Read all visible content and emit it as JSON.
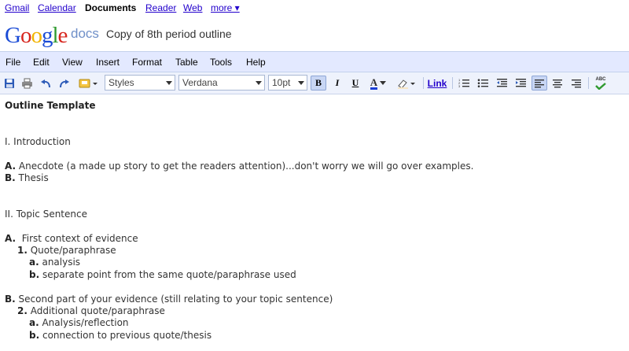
{
  "top_nav": {
    "gmail": "Gmail",
    "calendar": "Calendar",
    "documents": "Documents",
    "reader": "Reader",
    "web": "Web",
    "more": "more ▾"
  },
  "header": {
    "logo_letters": [
      "G",
      "o",
      "o",
      "g",
      "l",
      "e"
    ],
    "logo_colors": [
      "#1a4bd6",
      "#d7261e",
      "#f2b400",
      "#1a4bd6",
      "#2f9a2f",
      "#d7261e"
    ],
    "product": "docs",
    "doc_title": "Copy of 8th period outline"
  },
  "menu": {
    "file": "File",
    "edit": "Edit",
    "view": "View",
    "insert": "Insert",
    "format": "Format",
    "table": "Table",
    "tools": "Tools",
    "help": "Help"
  },
  "toolbar": {
    "styles": "Styles",
    "font": "Verdana",
    "size": "10pt",
    "bold": "B",
    "italic": "I",
    "underline": "U",
    "text_color": "A",
    "link": "Link",
    "spellcheck": "ABC"
  },
  "document": {
    "title": "Outline Template",
    "lines": {
      "intro": "I. Introduction",
      "a1_marker": "A.",
      "a1_text": " Anecdote (a made up story to get the readers attention)...don't worry we will go over examples.",
      "b1_marker": "B.",
      "b1_text": " Thesis",
      "topic": "II. Topic Sentence",
      "a2_marker": "A.",
      "a2_text": "  First context of evidence",
      "n1_marker": "1.",
      "n1_text": " Quote/paraphrase",
      "n1a_marker": "a.",
      "n1a_text": " analysis",
      "n1b_marker": "b.",
      "n1b_text": " separate point from the same quote/paraphrase used",
      "b2_marker": "B.",
      "b2_text": " Second part of your evidence (still relating to your topic sentence)",
      "n2_marker": "2.",
      "n2_text": " Additional quote/paraphrase",
      "n2a_marker": "a.",
      "n2a_text": " Analysis/reflection",
      "n2b_marker": "b.",
      "n2b_text": " connection to previous quote/thesis"
    }
  }
}
